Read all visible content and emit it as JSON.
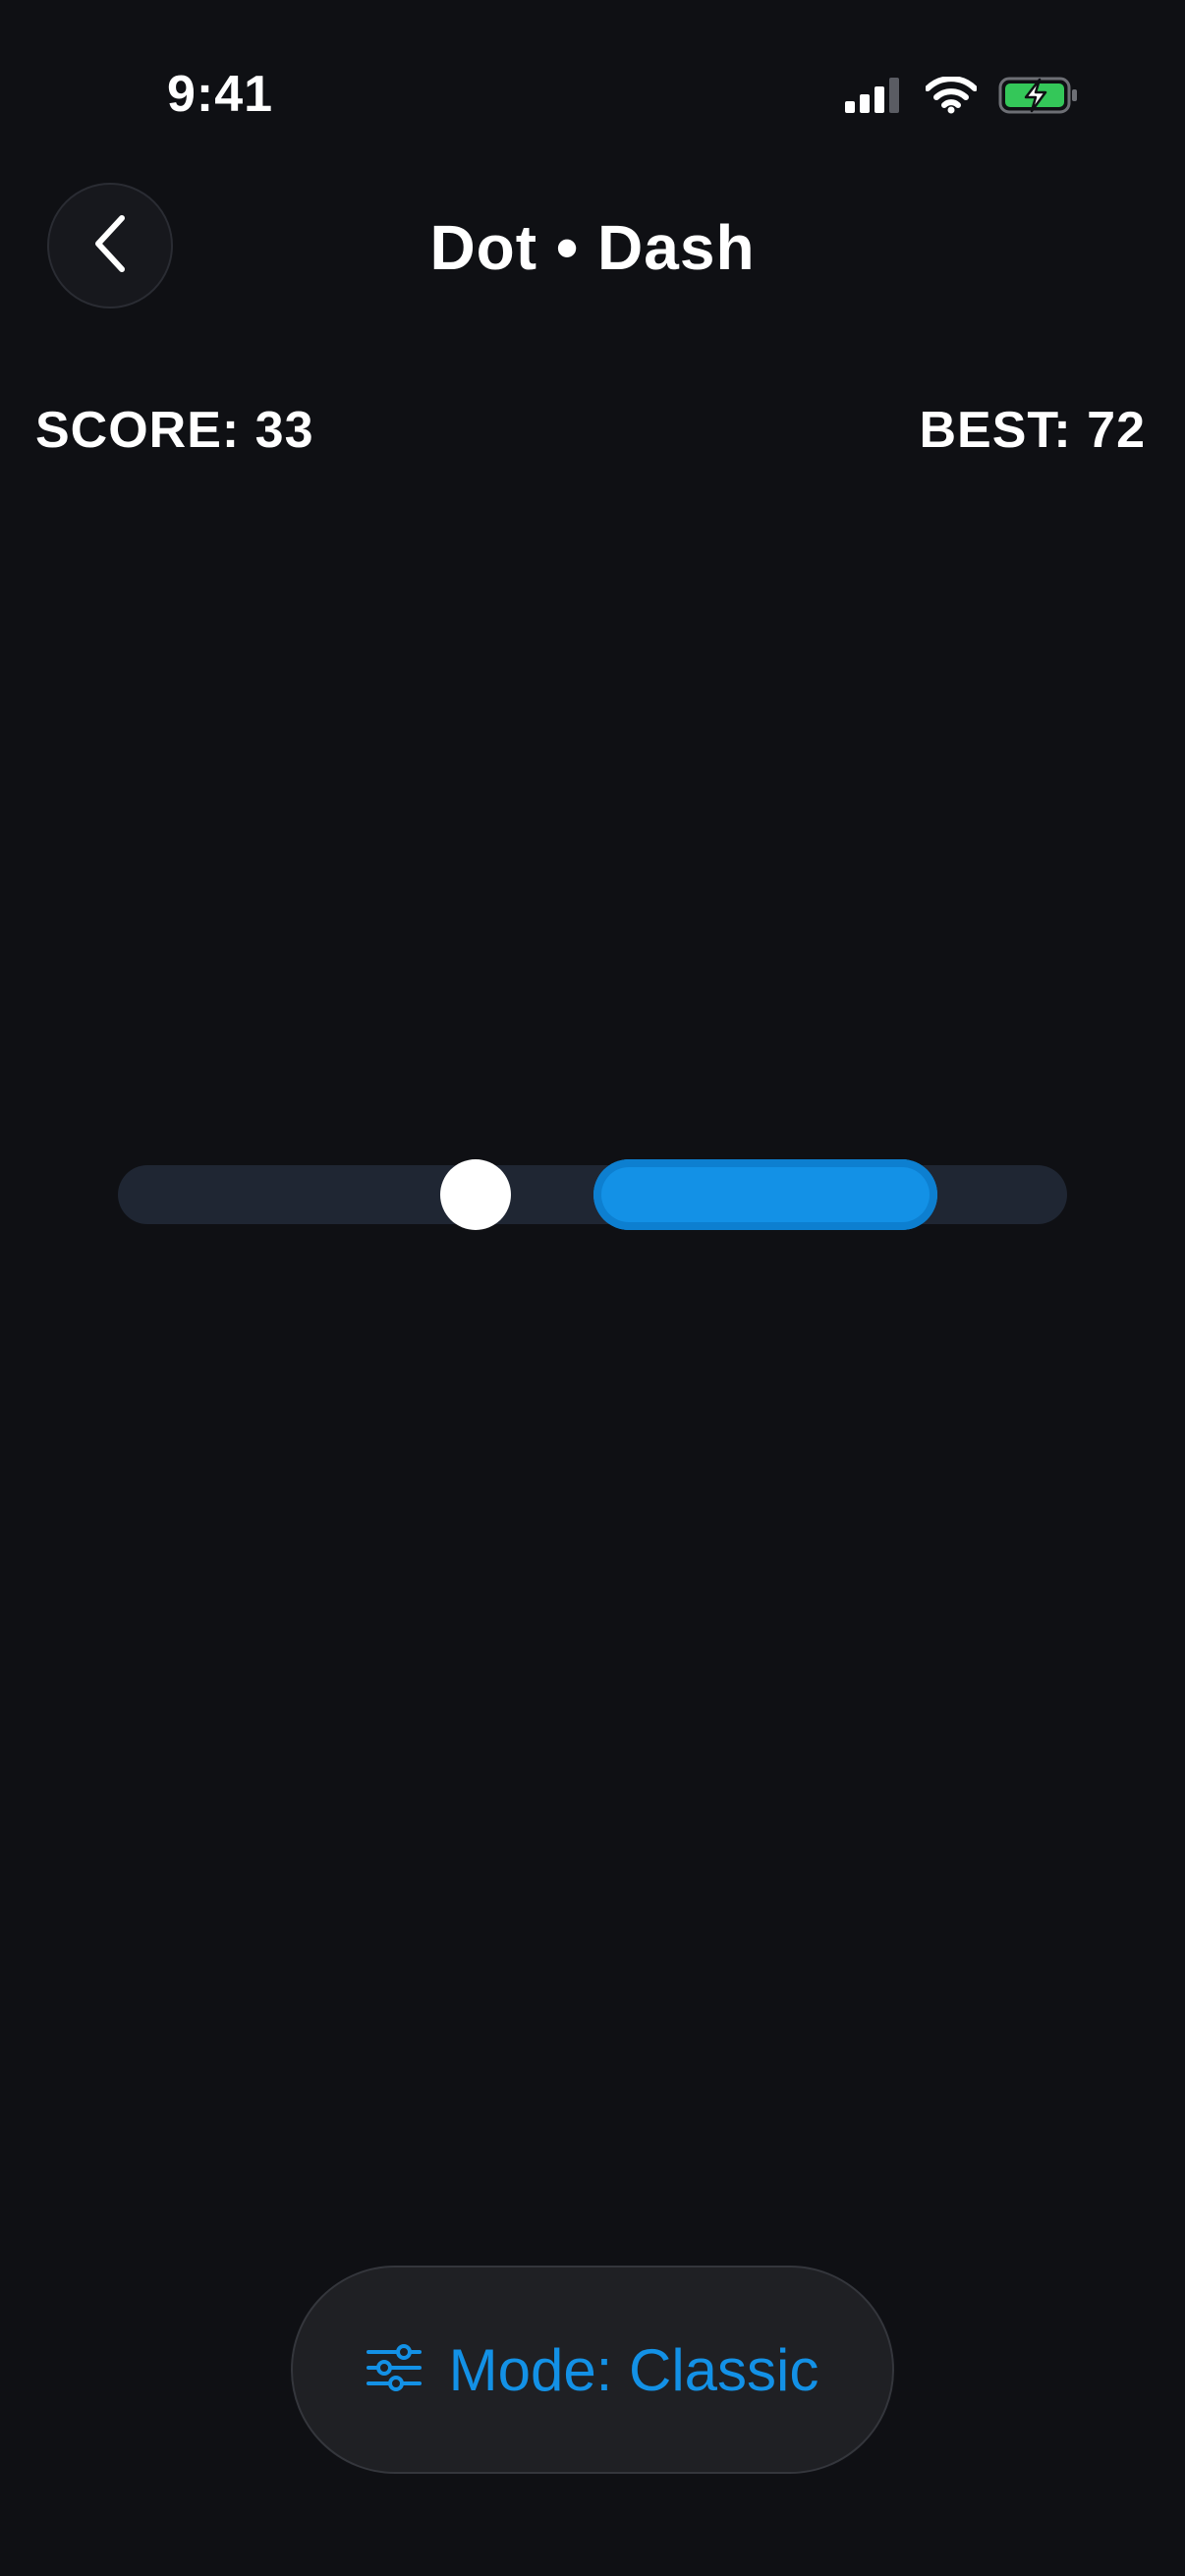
{
  "status_bar": {
    "time": "9:41"
  },
  "header": {
    "title": "Dot • Dash"
  },
  "scoreboard": {
    "score_label": "SCORE: 33",
    "best_label": "BEST: 72"
  },
  "game": {
    "dot_color": "#ffffff",
    "dash_color": "#1391e6",
    "track_color": "#1f2633"
  },
  "mode_button": {
    "label": "Mode: Classic"
  },
  "colors": {
    "background": "#0f1014",
    "accent": "#1391e6",
    "battery": "#34c759"
  },
  "icons": [
    "cellular-signal-icon",
    "wifi-icon",
    "battery-charging-icon",
    "chevron-left-icon",
    "sliders-icon"
  ]
}
